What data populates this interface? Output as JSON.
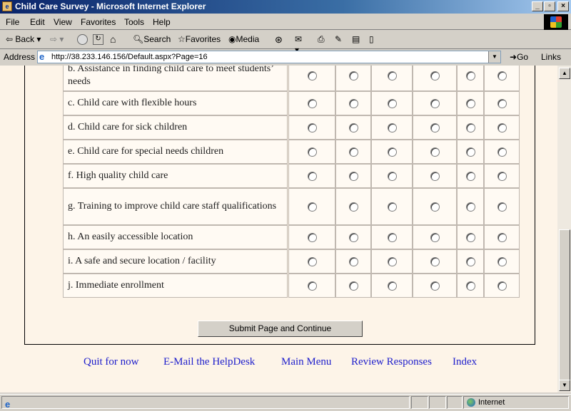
{
  "window": {
    "title": "Child Care Survey - Microsoft Internet Explorer"
  },
  "menu": [
    "File",
    "Edit",
    "View",
    "Favorites",
    "Tools",
    "Help"
  ],
  "toolbar": {
    "back": "Back",
    "search": "Search",
    "favorites": "Favorites",
    "media": "Media"
  },
  "address": {
    "label": "Address",
    "url": "http://38.233.146.156/Default.aspx?Page=16",
    "go": "Go",
    "links": "Links"
  },
  "survey": {
    "questions": [
      {
        "label": "b. Assistance in finding child care to meet students’ needs"
      },
      {
        "label": "c. Child care with flexible hours"
      },
      {
        "label": "d. Child care for sick children"
      },
      {
        "label": "e. Child care for special needs children"
      },
      {
        "label": "f. High quality child care"
      },
      {
        "label": "g. Training to improve child care staff qualifications"
      },
      {
        "label": "h. An easily accessible location"
      },
      {
        "label": "i. A safe and secure location / facility"
      },
      {
        "label": "j. Immediate enrollment"
      }
    ],
    "submit_label": "Submit Page and Continue"
  },
  "footer_links": [
    "Quit for now",
    "E-Mail the HelpDesk",
    "Main Menu",
    "Review Responses",
    "Index"
  ],
  "status": {
    "zone": "Internet"
  }
}
